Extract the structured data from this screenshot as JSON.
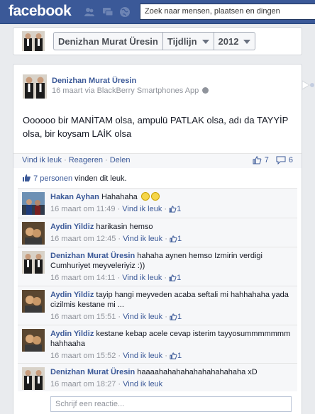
{
  "topbar": {
    "logo": "facebook",
    "search_placeholder": "Zoek naar mensen, plaatsen en dingen",
    "icons": [
      "friend-requests-icon",
      "messages-icon",
      "notifications-globe-icon"
    ]
  },
  "timeline_header": {
    "name": "Denizhan Murat Üresin",
    "tab": "Tijdlijn",
    "year": "2012"
  },
  "post": {
    "author": "Denizhan Murat Üresin",
    "meta": "16 maart via BlackBerry Smartphones App",
    "text": "Oooooo bir MANİTAM olsa, ampulü PATLAK olsa, adı da TAYYİP olsa, bir koysam LAİK olsa",
    "actions": {
      "like": "Vind ik leuk",
      "reply": "Reageren",
      "share": "Delen"
    },
    "like_count": "7",
    "comment_count": "6",
    "likes_link": "7 personen",
    "likes_rest": " vinden dit leuk."
  },
  "comments": [
    {
      "author": "Hakan Ayhan",
      "text": "Hahahaha",
      "smileys": 2,
      "time": "16 maart om 11:49",
      "like_label": "Vind ik leuk",
      "likes": "1"
    },
    {
      "author": "Aydin Yildiz",
      "text": "harikasin hemso",
      "time": "16 maart om 12:45",
      "like_label": "Vind ik leuk",
      "likes": "1"
    },
    {
      "author": "Denizhan Murat Üresin",
      "text": "hahaha aynen hemso Izmirin verdigi Cumhuriyet meyveleriyiz :))",
      "time": "16 maart om 14:11",
      "like_label": "Vind ik leuk",
      "likes": "1"
    },
    {
      "author": "Aydin Yildiz",
      "text": "tayip hangi meyveden acaba seftali mi hahhahaha yada cizilmis kestane mi ...",
      "time": "16 maart om 15:51",
      "like_label": "Vind ik leuk",
      "likes": "1"
    },
    {
      "author": "Aydin Yildiz",
      "text": "kestane kebap acele cevap isterim tayyosummmmmmm hahhaaha",
      "time": "16 maart om 15:52",
      "like_label": "Vind ik leuk",
      "likes": "1"
    },
    {
      "author": "Denizhan Murat Üresin",
      "text": "haaaahahahahahahahahahaha xD",
      "time": "16 maart om 18:27",
      "like_label": "Vind ik leuk",
      "likes": ""
    }
  ],
  "reply_placeholder": "Schrijf een reactie...",
  "colors": {
    "brand": "#3b5998",
    "link": "#3b5998",
    "meta": "#90949c"
  }
}
